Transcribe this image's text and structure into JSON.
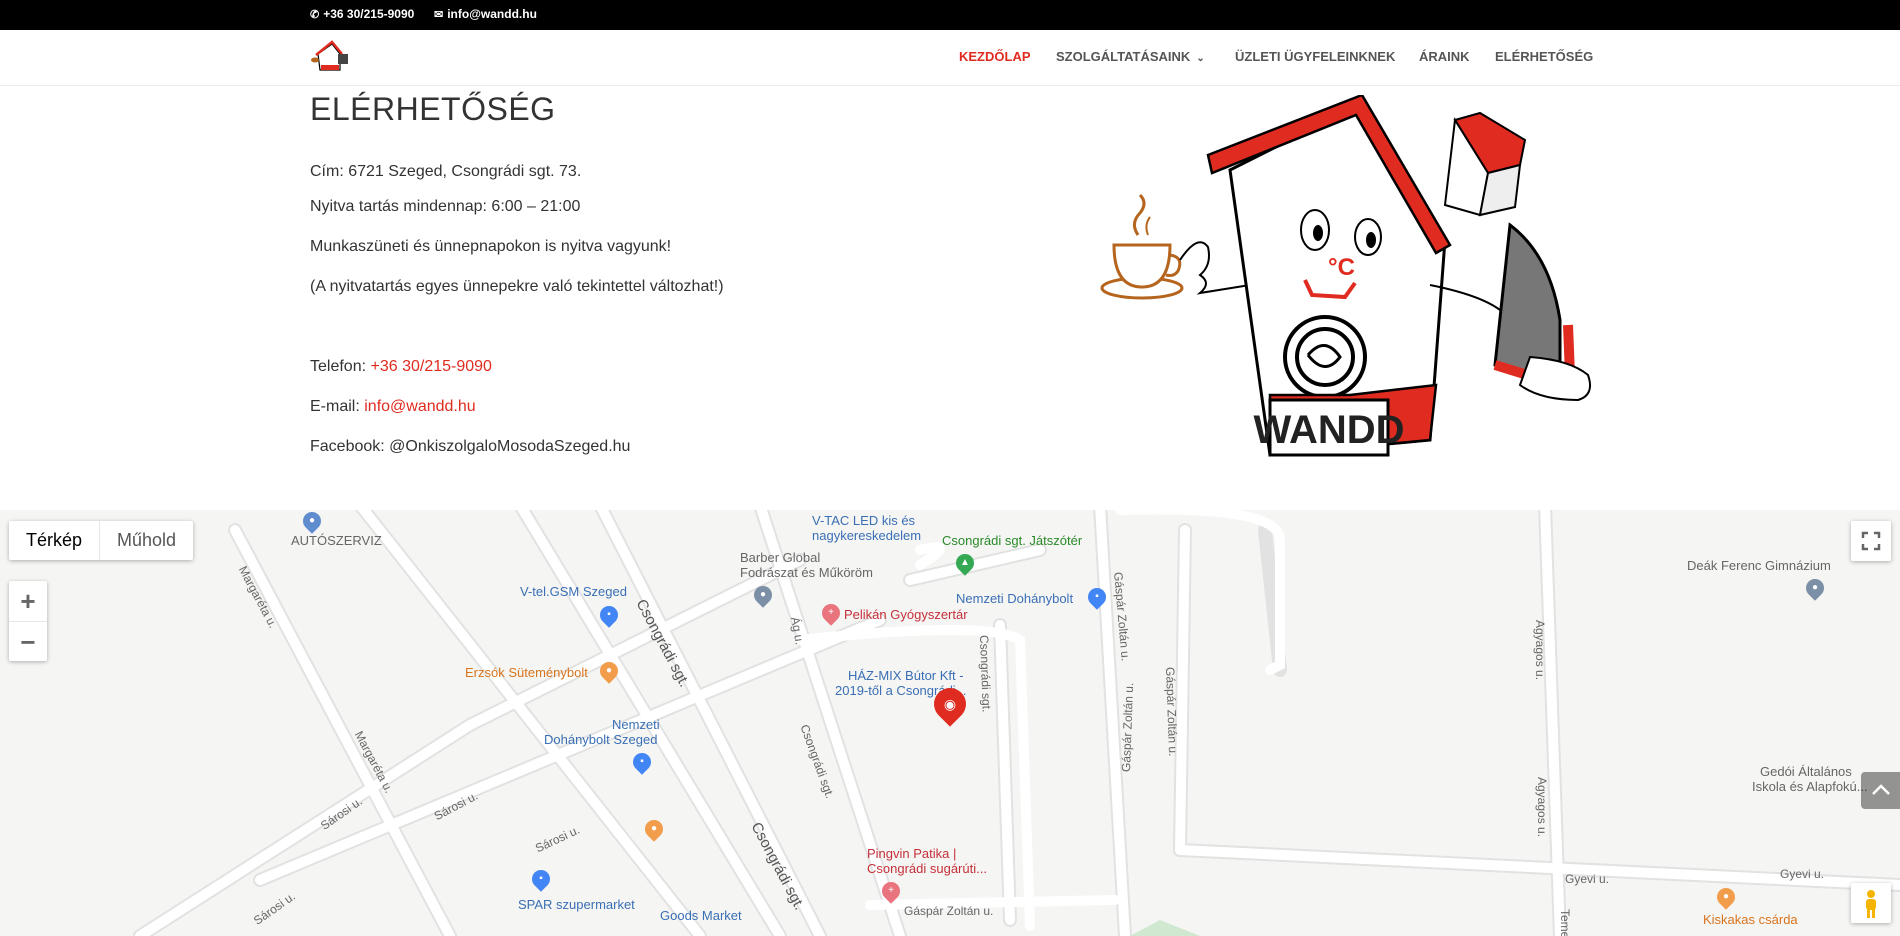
{
  "topbar": {
    "phone": "+36 30/215-9090",
    "email": "info@wandd.hu",
    "phone_icon": "phone-icon",
    "email_icon": "mail-icon"
  },
  "nav": {
    "items": [
      {
        "label": "KEZDŐLAP",
        "active": true
      },
      {
        "label": "SZOLGÁLTATÁSAINK",
        "dropdown": true
      },
      {
        "label": "ÜZLETI ÜGYFELEINKNEK"
      },
      {
        "label": "ÁRAINK"
      },
      {
        "label": "ELÉRHETŐSÉG"
      }
    ]
  },
  "contact": {
    "title": "ELÉRHETŐSÉG",
    "address": "Cím: 6721 Szeged, Csongrádi sgt. 73.",
    "hours": "Nyitva tartás mindennap: 6:00 – 21:00",
    "holiday": "Munkaszüneti és ünnepnapokon is nyitva vagyunk!",
    "note": "(A nyitvatartás egyes ünnepekre való tekintettel változhat!)",
    "phone_label": "Telefon: ",
    "phone_value": "+36 30/215-9090",
    "email_label": "E-mail: ",
    "email_value": "info@wandd.hu",
    "facebook": "Facebook: @OnkiszolgaloMosodaSzeged.hu"
  },
  "mascot": {
    "text": "WANDD",
    "badge": "°C"
  },
  "map": {
    "type_map": "Térkép",
    "type_satellite": "Műhold",
    "zoom_in": "+",
    "zoom_out": "−",
    "labels": {
      "autoszerviz": "AUTÓSZERVIZ",
      "vtac1": "V-TAC LED kis és",
      "vtac2": "nagykereskedelem",
      "jatszoter": "Csongrádi sgt. Játszótér",
      "barber1": "Barber Global",
      "barber2": "Fodrászat és Műköröm",
      "vtel": "V-tel.GSM Szeged",
      "pelikan": "Pelikán Gyógyszertár",
      "nemzeti1": "Nemzeti Dohánybolt",
      "deak": "Deák Ferenc Gimnázium",
      "erzsok": "Erzsók Süteménybolt",
      "hazmix1": "HÁZ-MIX Bútor Kft -",
      "hazmix2": "2019-től a Csongrádi...",
      "nemzeti2a": "Nemzeti",
      "nemzeti2b": "Dohánybolt Szeged",
      "gedoi1": "Gedói Általános",
      "gedoi2": "Iskola és Alapfokú...",
      "pingvin1": "Pingvin Patika |",
      "pingvin2": "Csongrádi sugárúti...",
      "spar": "SPAR szupermarket",
      "goods": "Goods Market",
      "kiskakas": "Kiskakas csárda"
    },
    "streets": {
      "margareta": "Margaréta u.",
      "csongradi": "Csongrádi sgt.",
      "agu": "Ág u.",
      "gaspar": "Gáspár Zoltán u.",
      "agyagos": "Agyagos u.",
      "sarosi": "Sárosi u.",
      "gyevi": "Gyevi u.",
      "temeto": "Temető"
    }
  }
}
